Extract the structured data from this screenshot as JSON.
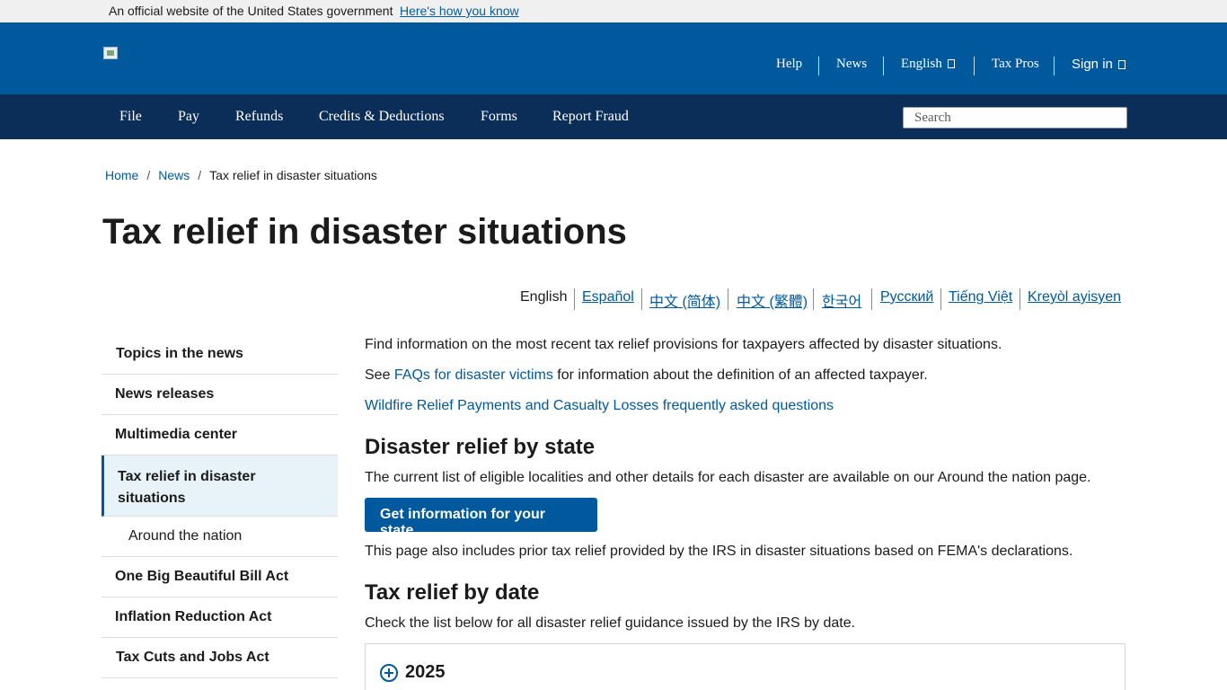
{
  "gov_banner": {
    "text": "An official website of the United States government",
    "link": "Here's how you know"
  },
  "header": {
    "util_nav": [
      "Help",
      "News",
      "English",
      "Tax Pros",
      "Sign in"
    ],
    "icons": [
      "globe-icon",
      "lock-icon"
    ]
  },
  "main_nav": {
    "items": [
      "File",
      "Pay",
      "Refunds",
      "Credits & Deductions",
      "Forms",
      "Report Fraud"
    ],
    "search_placeholder": "Search"
  },
  "breadcrumb": {
    "items": [
      "Home",
      "News",
      "Tax relief in disaster situations"
    ]
  },
  "page_title": "Tax relief in disaster situations",
  "languages": {
    "current": "English",
    "links": [
      "Español",
      "中文 (简体)",
      "中文 (繁體)",
      "한국어",
      "Русский",
      "Tiếng Việt",
      "Kreyòl ayisyen"
    ]
  },
  "sidebar": {
    "items": [
      "Topics in the news",
      "News releases",
      "Multimedia center",
      "Tax relief in disaster situations",
      "Around the nation",
      "One Big Beautiful Bill Act",
      "Inflation Reduction Act",
      "Tax Cuts and Jobs Act"
    ],
    "active_label_lines": [
      "Tax relief in disaster",
      "situations"
    ]
  },
  "content": {
    "intro": "Find information on the most recent tax relief provisions for taxpayers affected by disaster situations.",
    "see_prefix": "See ",
    "see_link": "FAQs for disaster victims",
    "see_suffix": " for information about the definition of an affected taxpayer.",
    "wildfire_link": "Wildfire Relief Payments and Casualty Losses frequently asked questions",
    "by_state_heading": "Disaster relief by state",
    "by_state_text": "The current list of eligible localities and other details for each disaster are available on our Around the nation page.",
    "state_button": "Get information for your state",
    "prior_text": "This page also includes prior tax relief provided by the IRS in disaster situations based on FEMA's declarations.",
    "by_date_heading": "Tax relief by date",
    "by_date_text": "Check the list below for all disaster relief guidance issued by the IRS by date.",
    "accordion_label": "2025"
  },
  "colors": {
    "header_blue": "#00599c",
    "nav_navy": "#0b2e59",
    "link_blue": "#00599c",
    "active_bg": "#e7f3f8"
  }
}
